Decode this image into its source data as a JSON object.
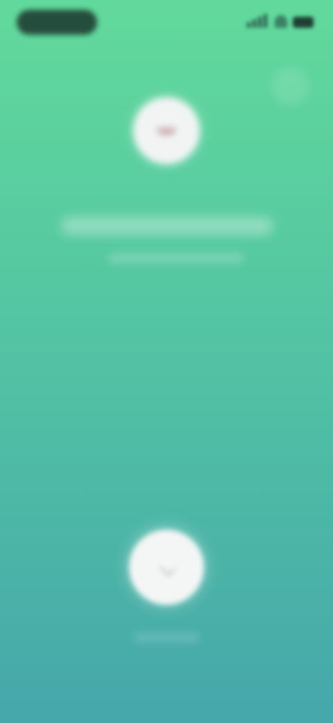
{
  "colors": {
    "gradient_top": "#62d99c",
    "gradient_bottom": "#46a7aa",
    "avatar_bg": "#f2f4f4",
    "action_button_bg": "#f4f6f5",
    "status_pill_bg": "#1f3f33"
  },
  "status_bar": {
    "time_pill": "",
    "signal_icon": "signal-icon",
    "wifi_icon": "wifi-icon",
    "battery_icon": "battery-icon"
  },
  "header": {
    "corner_icon": "minimize-icon"
  },
  "contact": {
    "avatar_icon": "avatar-icon",
    "name": "",
    "status": ""
  },
  "action": {
    "icon": "call-action-icon",
    "label": ""
  }
}
